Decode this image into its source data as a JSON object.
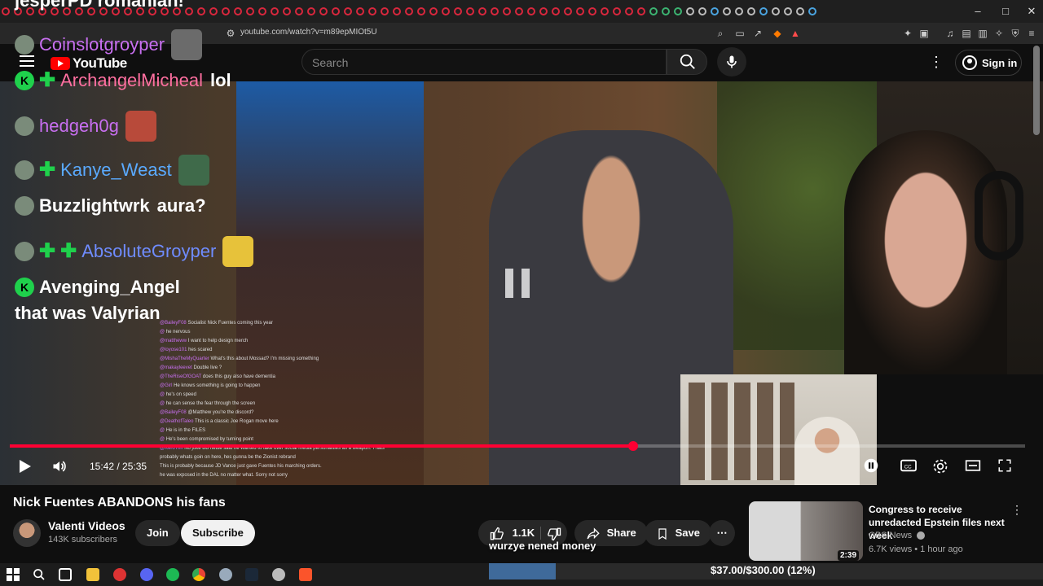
{
  "browser": {
    "url": "youtube.com/watch?v=m89epMIOt5U",
    "window_buttons": [
      "–",
      "□",
      "✕"
    ]
  },
  "header": {
    "logo_text": "YouTube",
    "search_placeholder": "Search",
    "signin_label": "Sign in"
  },
  "overlay_chat": {
    "top_partial": "jesperPD  romanian!",
    "lines": [
      {
        "user": "Coinslotgroyper",
        "msg": "",
        "color": "#c86ff0"
      },
      {
        "user": "ArchangelMicheal",
        "msg": "lol",
        "color": "#ff6fa0"
      },
      {
        "user": "hedgeh0g",
        "msg": "",
        "color": "#c86ff0"
      },
      {
        "user": "Kanye_Weast",
        "msg": "",
        "color": "#5aaaff"
      },
      {
        "user": "Buzzlightwrk",
        "msg": "aura?",
        "color": "#ffffff"
      },
      {
        "user": "AbsoluteGroyper",
        "msg": "",
        "color": "#6f8cff"
      },
      {
        "user": "Avenging_Angel",
        "msg": "",
        "color": "#ffffff"
      }
    ],
    "last_msg": "that was Valyrian"
  },
  "mini_chat": [
    {
      "user": "@BaileyF08",
      "msg": "Socialist Nick Fuentes coming this year"
    },
    {
      "user": "@",
      "msg": "he nervous"
    },
    {
      "user": "@mattheww",
      "msg": "I want to help design merch"
    },
    {
      "user": "@loyose101",
      "msg": "hes scared"
    },
    {
      "user": "@MishaTheMyQuarter",
      "msg": "What's this about Mossad? I'm missing something"
    },
    {
      "user": "@makayleevet",
      "msg": "Double live ?"
    },
    {
      "user": "@TheRiseOfGOAT",
      "msg": "does this guy also have dementia"
    },
    {
      "user": "@Girl",
      "msg": "He knows something is going to happen"
    },
    {
      "user": "@",
      "msg": "he's on speed"
    },
    {
      "user": "@",
      "msg": "he can sense the fear through the screen"
    },
    {
      "user": "@BaileyF08",
      "msg": "@Matthew you're the discord?"
    },
    {
      "user": "@DeathofTaleo",
      "msg": "This is a classic Joe Rogan move here"
    },
    {
      "user": "@",
      "msg": "He is in the FILES"
    },
    {
      "user": "@",
      "msg": "He's been compromised by turning point"
    },
    {
      "user": "@KeroTim",
      "msg": "No joke BB nettle said he wanted to take over social media personalities as a weapon. Thats"
    },
    {
      "user": "",
      "msg": "probably whats goin on here, hes gunna be the Zionist rebrand"
    },
    {
      "user": "",
      "msg": "This is probably because JD Vance just gave Fuentes his marching orders."
    },
    {
      "user": "",
      "msg": "he was exposed in the DAL no matter what. Sorry not sorry"
    }
  ],
  "player": {
    "time": "15:42 / 25:35",
    "progress": 0.614
  },
  "video": {
    "title": "Nick Fuentes ABANDONS his fans",
    "channel": "Valenti Videos",
    "subscribers": "143K subscribers",
    "join_label": "Join",
    "subscribe_label": "Subscribe",
    "likes": "1.1K",
    "share_label": "Share",
    "save_label": "Save",
    "caption_overlay": "wurzye nened money"
  },
  "recommendation": {
    "title": "Congress to receive unredacted Epstein files next week",
    "channel": "CBS News",
    "meta": "6.7K views • 1 hour ago",
    "duration": "2:39"
  },
  "donation": {
    "text": "$37.00/$300.00 (12%)",
    "fraction": 0.12
  },
  "colors": {
    "accent": "#ff0033",
    "background": "#0f0f0f",
    "badge_green": "#1fd14c"
  }
}
